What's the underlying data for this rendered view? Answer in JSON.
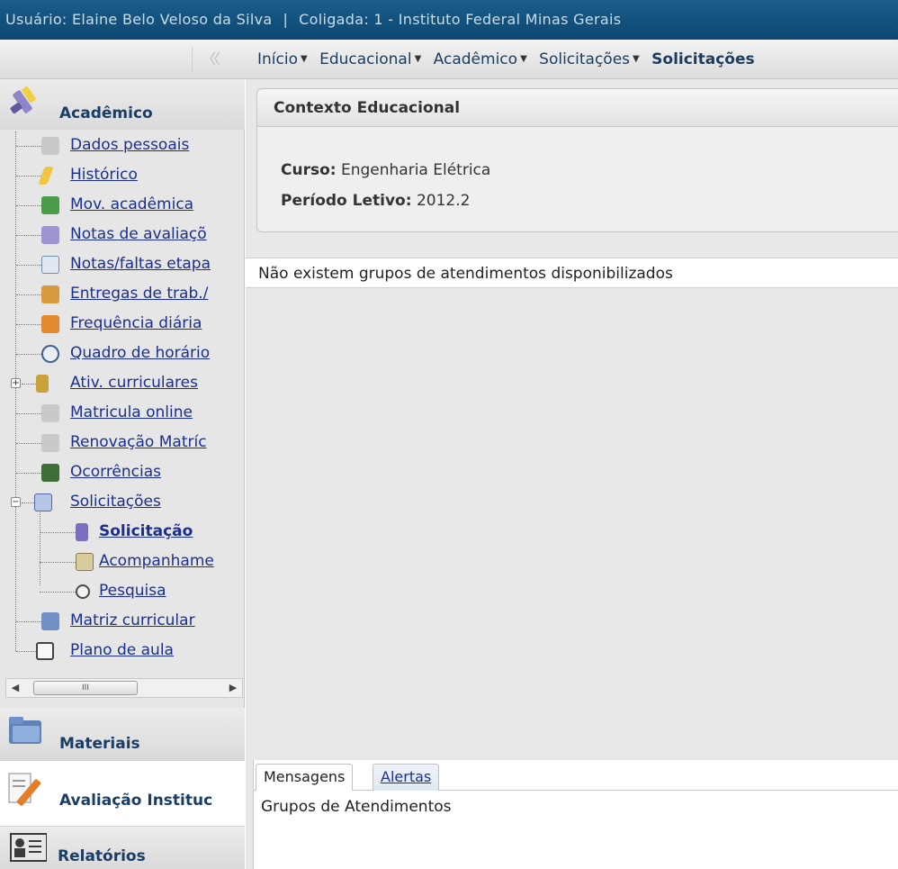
{
  "header": {
    "user_text": "Usuário: Elaine Belo Veloso da Silva",
    "separator": "|",
    "coligada_text": "Coligada: 1 - Instituto Federal Minas Gerais"
  },
  "menubar": {
    "collapse_glyph": "〈〈",
    "items": [
      "Início",
      "Educacional",
      "Acadêmico",
      "Solicitações"
    ],
    "current": "Solicitações"
  },
  "sidebar": {
    "academico_title": "Acadêmico",
    "tree": [
      {
        "label": "Dados pessoais",
        "icon": "user-card-icon"
      },
      {
        "label": "Histórico",
        "icon": "pencil-icon"
      },
      {
        "label": "Mov. acadêmica",
        "icon": "arrows-icon"
      },
      {
        "label": "Notas de avaliaçõ",
        "icon": "chart-icon"
      },
      {
        "label": "Notas/faltas etapa",
        "icon": "grid-icon"
      },
      {
        "label": "Entregas de trab./",
        "icon": "inbox-icon"
      },
      {
        "label": "Frequência diária",
        "icon": "calendar-icon"
      },
      {
        "label": "Quadro de horário",
        "icon": "clock-icon"
      },
      {
        "label": "Ativ. curriculares",
        "icon": "person-icon"
      },
      {
        "label": "Matricula online",
        "icon": "user-card-icon"
      },
      {
        "label": "Renovação Matríc",
        "icon": "user-card-icon"
      },
      {
        "label": "Ocorrências",
        "icon": "megaphone-icon"
      },
      {
        "label": "Solicitações",
        "icon": "request-icon"
      },
      {
        "label": "Solicitação",
        "icon": "pen-icon"
      },
      {
        "label": "Acompanhame",
        "icon": "calendar-check-icon"
      },
      {
        "label": "Pesquisa",
        "icon": "magnifier-icon"
      },
      {
        "label": "Matriz curricular",
        "icon": "check-icon"
      },
      {
        "label": "Plano de aula",
        "icon": "book-icon"
      }
    ],
    "scroll_thumb": "III",
    "materiais_title": "Materiais",
    "avaliacao_title": "Avaliação Instituc",
    "relatorios_title": "Relatórios"
  },
  "main": {
    "context_title": "Contexto Educacional",
    "curso_label": "Curso:",
    "curso_value": "Engenharia Elétrica",
    "periodo_label": "Período Letivo:",
    "periodo_value": "2012.2",
    "empty_message": "Não existem grupos de atendimentos disponibilizados",
    "tabs": [
      "Mensagens",
      "Alertas"
    ],
    "bottom_text": "Grupos de Atendimentos"
  },
  "colors": {
    "header_bg": "#0d4770",
    "link": "#1b2f8f",
    "title": "#1a3d66"
  }
}
